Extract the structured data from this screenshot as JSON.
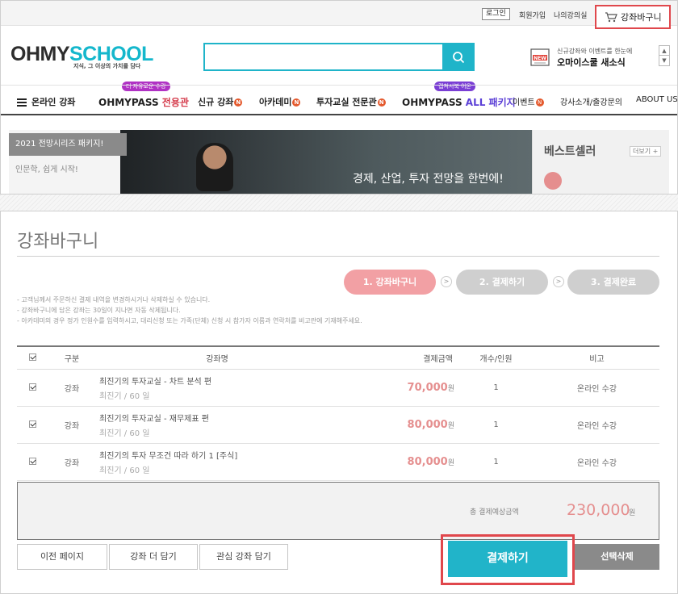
{
  "util": {
    "login": "로그인",
    "signup": "회원가입",
    "my_lectures": "나의강의실",
    "cart": "강좌바구니"
  },
  "logo": {
    "part1": "OHMY",
    "part2": "SCHOOL",
    "tagline": "지식, 그 이상의 가치를 담다"
  },
  "news": {
    "sub": "신규강좌와 이벤트를 한눈에",
    "main": "오마이스쿨 새소식",
    "icon_label": "NEW"
  },
  "nav": {
    "menu": "온라인 강좌",
    "pass1_tag": "더 자유로운 수강",
    "pass1_a": "OHMYPASS",
    "pass1_b": "전용관",
    "new_courses": "신규 강좌",
    "academy": "아카데미",
    "invest": "투자교실 전문관",
    "pass2_tag": "캡쳐시북 이온",
    "pass2_a": "OHMYPASS",
    "pass2_b": "ALL 패키지",
    "event": "이벤트",
    "teacher": "강사소개/출강문의",
    "about": "ABOUT US",
    "badge": "N"
  },
  "banner": {
    "tab1": "2021 전망시리즈 패키지!",
    "tab2": "인문학, 쉽게 시작!",
    "text": "경제, 산업, 투자 전망을 한번에!"
  },
  "best": {
    "title": "베스트셀러",
    "more": "더보기 +"
  },
  "cart": {
    "title": "강좌바구니",
    "steps": [
      "1. 강좌바구니",
      "2. 결제하기",
      "3. 결제완료"
    ],
    "step_arrow": ">",
    "notes": [
      "- 고객님께서 주문하신 결제 내역을 변경하시거나 삭제하실 수 있습니다.",
      "- 강좌바구니에 담은 강좌는 30일이 지나면 자동 삭제됩니다.",
      "- 아카데미의 경우 정가 인원수를 입력하시고, 대리신청 또는 가족(단체) 신청 시 참가자 이름과 연락처를 비고란에 기재해주세요."
    ],
    "headers": {
      "type": "구분",
      "name": "강좌명",
      "price": "결제금액",
      "qty": "개수/인원",
      "note": "비고"
    },
    "items": [
      {
        "type": "강좌",
        "title": "최진기의 투자교실 - 차트 분석 편",
        "sub": "최진기 / 60 일",
        "price": "70,000",
        "won": "원",
        "qty": "1",
        "note": "온라인 수강"
      },
      {
        "type": "강좌",
        "title": "최진기의 투자교실 - 재무제표 편",
        "sub": "최진기 / 60 일",
        "price": "80,000",
        "won": "원",
        "qty": "1",
        "note": "온라인 수강"
      },
      {
        "type": "강좌",
        "title": "최진기의 투자 무조건 따라 하기 1 [주식]",
        "sub": "최진기 / 60 일",
        "price": "80,000",
        "won": "원",
        "qty": "1",
        "note": "온라인 수강"
      }
    ],
    "total_label": "총 결제예상금액",
    "total": "230,000",
    "total_won": "원",
    "buttons": {
      "prev": "이전 페이지",
      "more": "강좌 더 담기",
      "fav": "관심 강좌 담기",
      "pay": "결제하기",
      "delete": "선택삭제"
    }
  },
  "colors": {
    "accent": "#21b4c9",
    "highlight_outline": "#e0474c",
    "price": "#e58f8f"
  }
}
